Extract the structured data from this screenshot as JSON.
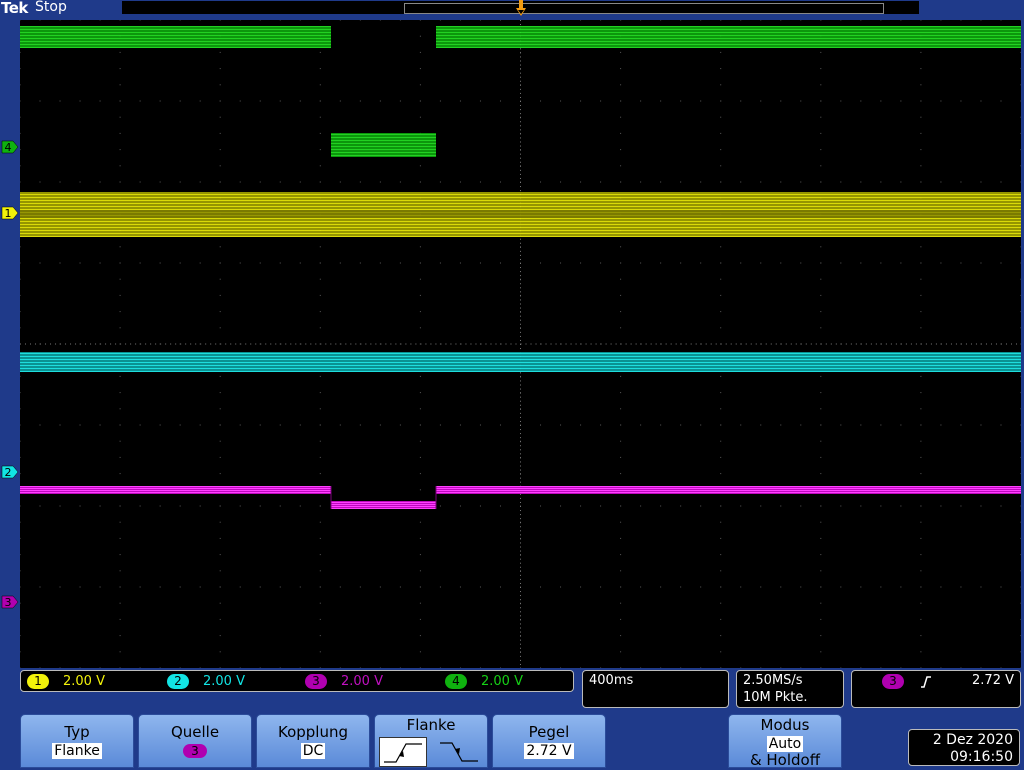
{
  "topbar": {
    "brand": "Tek",
    "state": "Stop"
  },
  "trace_colors": {
    "ch1": "#f2f20a",
    "ch2": "#12e4e4",
    "ch3": "#e60be6",
    "ch4": "#16d016"
  },
  "channels": [
    {
      "id": "1",
      "scale": "2.00 V",
      "color": "#f2f20a",
      "text_color": "#f2f20a"
    },
    {
      "id": "2",
      "scale": "2.00 V",
      "color": "#12e4e4",
      "text_color": "#12e4e4"
    },
    {
      "id": "3",
      "scale": "2.00 V",
      "color": "#b000b0",
      "text_color": "#c010c0"
    },
    {
      "id": "4",
      "scale": "2.00 V",
      "color": "#0fb20f",
      "text_color": "#16d016"
    }
  ],
  "timebase": {
    "scale": "400ms"
  },
  "acquisition": {
    "sample_rate": "2.50MS/s",
    "record_length": "10M Pkte."
  },
  "trigger_readout": {
    "source": "3",
    "slope_icon": "rising-edge-icon",
    "level": "2.72 V"
  },
  "menu": {
    "typ": {
      "title": "Typ",
      "value": "Flanke"
    },
    "quelle": {
      "title": "Quelle",
      "value": "3"
    },
    "kopplung": {
      "title": "Kopplung",
      "value": "DC"
    },
    "flanke": {
      "title": "Flanke",
      "options": [
        "rising-edge-icon",
        "falling-edge-icon"
      ],
      "selected": "rising-edge-icon"
    },
    "pegel": {
      "title": "Pegel",
      "value": "2.72 V"
    },
    "modus": {
      "title": "Modus",
      "value": "Auto",
      "subtitle": "& Holdoff"
    }
  },
  "datetime": {
    "date": "2 Dez  2020",
    "time": "09:16:50"
  }
}
